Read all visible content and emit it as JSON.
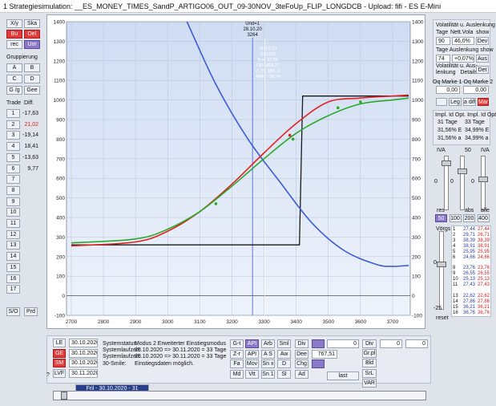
{
  "title": "1   Strategiesimulation:  __ES_MONEY_TIMES_SandP_ARTIGO06_OUT_09-30NOV_3teFoUp_FLIP_LONGDCB  -  Upload: fifi  -  ES  E-Mini",
  "left": {
    "row1": [
      "X/y",
      "Ska"
    ],
    "row2": [
      "Bu",
      "Del"
    ],
    "row3": [
      "rec",
      "Um"
    ],
    "grouping_label": "Gruppierung",
    "groups": [
      "A",
      "B",
      "C",
      "D"
    ],
    "row_gg": [
      "G /g",
      "Gee"
    ],
    "trade_header": "Trade",
    "diff_header": "Diff.",
    "trades": [
      {
        "n": "1",
        "v": "-17,63",
        "c": "#111"
      },
      {
        "n": "2",
        "v": "21,02",
        "c": "#d02020"
      },
      {
        "n": "3",
        "v": "-19,14",
        "c": "#111"
      },
      {
        "n": "4",
        "v": "18,41",
        "c": "#111"
      },
      {
        "n": "5",
        "v": "-13,63",
        "c": "#111"
      },
      {
        "n": "6",
        "v": "9,77",
        "c": "#111"
      },
      {
        "n": "7",
        "v": "",
        "c": "#111"
      },
      {
        "n": "8",
        "v": "",
        "c": "#111"
      },
      {
        "n": "9",
        "v": "",
        "c": "#111"
      },
      {
        "n": "10",
        "v": "",
        "c": "#111"
      },
      {
        "n": "11",
        "v": "",
        "c": "#111"
      },
      {
        "n": "12",
        "v": "",
        "c": "#111"
      },
      {
        "n": "13",
        "v": "",
        "c": "#111"
      },
      {
        "n": "14",
        "v": "",
        "c": "#111"
      },
      {
        "n": "15",
        "v": "",
        "c": "#111"
      },
      {
        "n": "16",
        "v": "",
        "c": "#111"
      },
      {
        "n": "17",
        "v": "",
        "c": "#111"
      }
    ],
    "bottom": [
      "S/O",
      "Prd"
    ]
  },
  "right": {
    "vol_title": "Volatilität u. Auslenkung",
    "vol_cols": [
      "Tage",
      "Nett.Vola",
      "show"
    ],
    "vol_row": {
      "tage": "90",
      "vola": "46,0%",
      "btn": "Dev"
    },
    "tage_title": "Tage Auslenkung show",
    "tage_row": {
      "tage": "74",
      "pct": "+0,07%",
      "btn": "Aus"
    },
    "aus_title": "Volatilität u. Aus-\nlenkung   Details:",
    "aus_btn": "Det",
    "marke_title": "Oq Marke 1  Oq Marke 2",
    "marke_vals": [
      "0,00",
      "0,00"
    ],
    "row_btns": [
      "",
      "Leg",
      "a diff",
      "Marke"
    ],
    "impl_title": "Impl. Id Opt.  Impl. Id Opt.",
    "impl_tage": [
      "31 Tage",
      "33 Tage"
    ],
    "impl_r1": [
      "31,56% E",
      "34,99% E"
    ],
    "impl_r2": [
      "31,56% a",
      "34,99% a"
    ],
    "iva_labels": [
      "IVA",
      "50",
      "IVA"
    ],
    "iva_vals": [
      "0",
      "0",
      "0"
    ],
    "slider_bottom": [
      "res",
      "abs",
      "alle"
    ],
    "range_btns": [
      "50",
      "100",
      "200",
      "400"
    ],
    "vorgs_label": "Vörgs",
    "vorgs": [
      {
        "i": "1",
        "a": "27,44",
        "b": "27,44"
      },
      {
        "i": "2",
        "a": "29,71",
        "b": "26,71"
      },
      {
        "i": "3",
        "a": "38,39",
        "b": "38,39"
      },
      {
        "i": "4",
        "a": "38,91",
        "b": "38,91"
      },
      {
        "i": "5",
        "a": "25,95",
        "b": "25,95"
      },
      {
        "i": "6",
        "a": "24,66",
        "b": "24,66"
      },
      {
        "i": "",
        "a": "",
        "b": ""
      },
      {
        "i": "8",
        "a": "23,76",
        "b": "23,76"
      },
      {
        "i": "9",
        "a": "26,55",
        "b": "26,55"
      },
      {
        "i": "10",
        "a": "25,13",
        "b": "25,13"
      },
      {
        "i": "11",
        "a": "27,43",
        "b": "27,43"
      },
      {
        "i": "",
        "a": "",
        "b": ""
      },
      {
        "i": "13",
        "a": "22,62",
        "b": "22,62"
      },
      {
        "i": "14",
        "a": "27,86",
        "b": "27,86"
      },
      {
        "i": "15",
        "a": "36,21",
        "b": "36,21"
      },
      {
        "i": "16",
        "a": "36,76",
        "b": "36,76"
      }
    ],
    "vorgs_side": [
      "0",
      "-25"
    ],
    "reset": "reset"
  },
  "bottom": {
    "date_btns": [
      "LE",
      "GE",
      "SM",
      "LVF"
    ],
    "dates": [
      "30.10.2020",
      "30.10.2020",
      "30.10.2020",
      "30.11.2020"
    ],
    "sys_label": "Systemstatus:",
    "sys_value": "Modus 2  Erweiterter Einstiegsmodus",
    "sys_lauf_label": "Systemlaufzeit:",
    "sys_lauf_value": "28.10.2020 => 30.11.2020 = 33 Tage",
    "sys_lauf2_label": "Systemlaufzeit:",
    "sys_lauf2_value": "28.10.2020 => 30.11.2020 = 33 Tage",
    "smile_label": "30-Smile:",
    "smile_value": "Einstiegsdaten möglich.",
    "grid_btns": [
      [
        "G-t",
        "API",
        "Arb",
        "Sml"
      ],
      [
        "Z-r",
        "API",
        "A S",
        "Aw"
      ],
      [
        "Fa",
        "Mov",
        "Sn x",
        "D"
      ],
      [
        "Md",
        "Vtt",
        "Sn 1",
        "Sl"
      ]
    ],
    "grid_right": [
      "Div",
      "Dee",
      "Chg",
      "Ad"
    ],
    "num_fields": [
      "0",
      "0",
      "0"
    ],
    "value_767": "767,51",
    "right_col": [
      "Div",
      "Gr.pl",
      "Bld",
      "SrL",
      "VAR"
    ],
    "last_btn": "last",
    "timeline": "Fril - 30.10.2020 - 31",
    "question": "?"
  },
  "chart_data": {
    "type": "line",
    "x_ticks": [
      2700,
      2800,
      2900,
      3000,
      3100,
      3200,
      3300,
      3400,
      3500,
      3600,
      3700
    ],
    "y_ticks": [
      1400,
      1300,
      1200,
      1100,
      1000,
      900,
      800,
      700,
      600,
      500,
      400,
      300,
      200,
      100,
      0,
      -100
    ],
    "xlim": [
      2675,
      5775
    ],
    "ylim": [
      -100,
      1400
    ],
    "cursor": {
      "label_date": "Und=1",
      "label_value": "28.10.20",
      "label_price": "3264",
      "x": 3264,
      "x2": 3302
    },
    "tooltip": [
      "30.10.20",
      "SI  3302",
      "N.e. 31,98",
      "CPL 824,27",
      "-1,75, 988,11",
      "4846 - 30,74"
    ],
    "series": [
      {
        "color": "#1a1a1a",
        "x": [
          2700,
          3410,
          3420,
          3750
        ],
        "y": [
          260,
          260,
          1020,
          1020
        ]
      },
      {
        "color": "#3c5bd3",
        "x": [
          3060,
          3150,
          3250,
          3350,
          3450,
          3550,
          3650,
          3700,
          3750
        ],
        "y": [
          1400,
          1080,
          800,
          580,
          370,
          230,
          160,
          150,
          155
        ]
      },
      {
        "color": "#e02222",
        "x": [
          2700,
          2900,
          3000,
          3100,
          3200,
          3300,
          3400,
          3500,
          3600,
          3700,
          3750
        ],
        "y": [
          255,
          275,
          330,
          430,
          570,
          730,
          880,
          990,
          1010,
          1020,
          1025
        ]
      },
      {
        "color": "#2aa82a",
        "x": [
          2700,
          2900,
          3000,
          3100,
          3200,
          3300,
          3400,
          3500,
          3600,
          3700,
          3750
        ],
        "y": [
          270,
          290,
          340,
          430,
          560,
          700,
          830,
          920,
          980,
          1000,
          1010
        ]
      }
    ]
  }
}
